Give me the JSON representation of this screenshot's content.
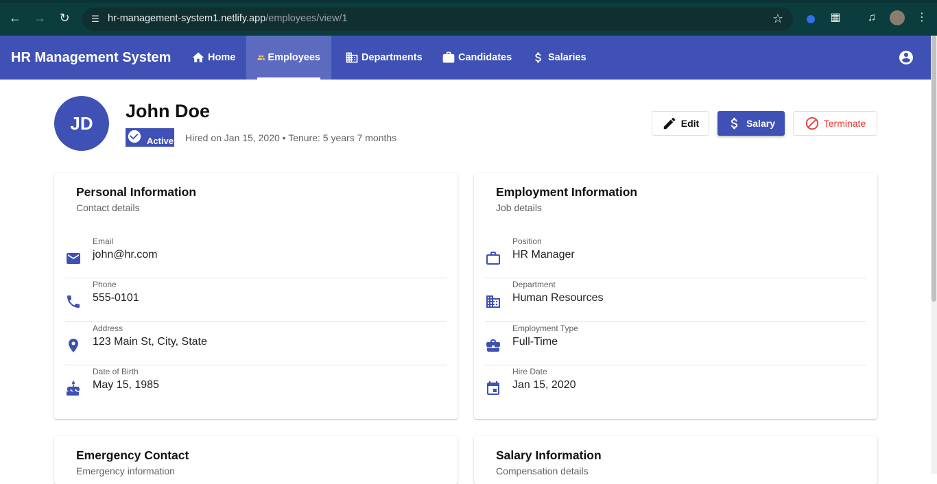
{
  "browser": {
    "url_host": "hr-management-system1.netlify.app",
    "url_path": "/employees/view/1"
  },
  "app": {
    "brand": "HR Management System",
    "nav": [
      {
        "label": "Home",
        "icon": "home-icon"
      },
      {
        "label": "Employees",
        "icon": "people-icon",
        "active": true
      },
      {
        "label": "Departments",
        "icon": "building-icon"
      },
      {
        "label": "Candidates",
        "icon": "briefcase-icon"
      },
      {
        "label": "Salaries",
        "icon": "dollar-icon"
      }
    ],
    "colors": {
      "primary": "#3f51b5",
      "active_nav_icon": "#ffd54f",
      "danger": "#e53935"
    }
  },
  "employee": {
    "initials": "JD",
    "name": "John Doe",
    "status": "Active",
    "hire_info": "Hired on Jan 15, 2020 • Tenure: 5 years 7 months"
  },
  "actions": {
    "edit": "Edit",
    "salary": "Salary",
    "terminate": "Terminate"
  },
  "personal": {
    "title": "Personal Information",
    "subtitle": "Contact details",
    "fields": [
      {
        "label": "Email",
        "value": "john@hr.com",
        "icon": "email-icon"
      },
      {
        "label": "Phone",
        "value": "555-0101",
        "icon": "phone-icon"
      },
      {
        "label": "Address",
        "value": "123 Main St, City, State",
        "icon": "location-icon"
      },
      {
        "label": "Date of Birth",
        "value": "May 15, 1985",
        "icon": "cake-icon"
      }
    ]
  },
  "employment": {
    "title": "Employment Information",
    "subtitle": "Job details",
    "fields": [
      {
        "label": "Position",
        "value": "HR Manager",
        "icon": "work-outline-icon"
      },
      {
        "label": "Department",
        "value": "Human Resources",
        "icon": "building-icon"
      },
      {
        "label": "Employment Type",
        "value": "Full-Time",
        "icon": "business-center-icon"
      },
      {
        "label": "Hire Date",
        "value": "Jan 15, 2020",
        "icon": "calendar-icon"
      }
    ]
  },
  "emergency": {
    "title": "Emergency Contact",
    "subtitle": "Emergency information"
  },
  "salary": {
    "title": "Salary Information",
    "subtitle": "Compensation details"
  }
}
